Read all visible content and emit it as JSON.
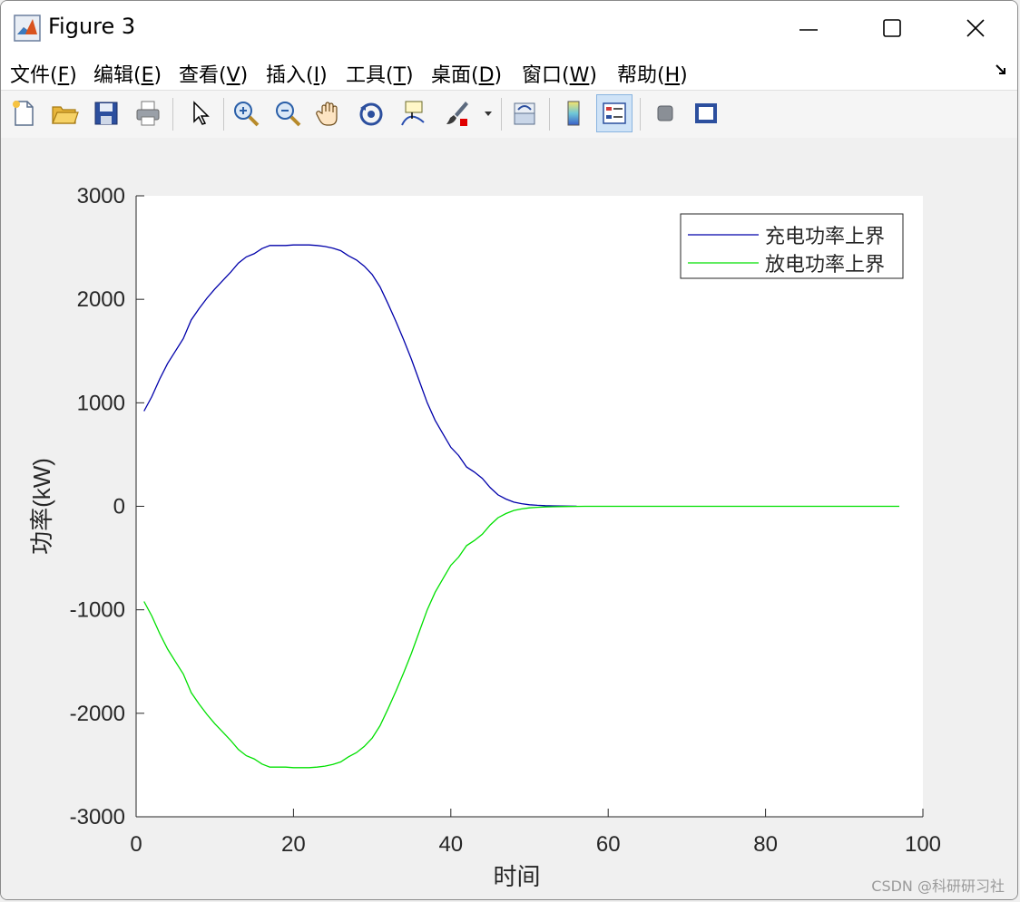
{
  "window": {
    "title": "Figure 3",
    "icons": {
      "app": "matlab-logo-icon",
      "minimize": "minimize-icon",
      "maximize": "maximize-icon",
      "close": "close-icon"
    }
  },
  "menu": {
    "items": [
      {
        "label": "文件(",
        "key": "F",
        "end": ")"
      },
      {
        "label": "编辑(",
        "key": "E",
        "end": ")"
      },
      {
        "label": "查看(",
        "key": "V",
        "end": ")"
      },
      {
        "label": "插入(",
        "key": "I",
        "end": ")"
      },
      {
        "label": "工具(",
        "key": "T",
        "end": ")"
      },
      {
        "label": "桌面(",
        "key": "D",
        "end": ")"
      },
      {
        "label": "窗口(",
        "key": "W",
        "end": ")"
      },
      {
        "label": "帮助(",
        "key": "H",
        "end": ")"
      }
    ],
    "dock_icon": "dock-arrow-icon"
  },
  "toolbar": {
    "buttons": [
      "new-figure-icon",
      "open-file-icon",
      "save-icon",
      "print-icon",
      "select-pointer-icon",
      "zoom-in-icon",
      "zoom-out-icon",
      "pan-hand-icon",
      "rotate-3d-icon",
      "data-cursor-icon",
      "brush-icon",
      "brush-dropdown-icon",
      "link-plot-icon",
      "colorbar-icon",
      "legend-icon",
      "hide-plot-tools-icon",
      "show-plot-tools-icon"
    ],
    "active": "legend-icon"
  },
  "watermark": "CSDN @科研研习社",
  "chart_data": {
    "type": "line",
    "title": "",
    "xlabel": "时间",
    "ylabel": "功率(kW)",
    "xlim": [
      0,
      100
    ],
    "ylim": [
      -3000,
      3000
    ],
    "xticks": [
      0,
      20,
      40,
      60,
      80,
      100
    ],
    "yticks": [
      3000,
      2000,
      1000,
      0,
      -1000,
      -2000,
      -3000
    ],
    "grid": false,
    "legend_position": "top-right",
    "series": [
      {
        "name": "充电功率上界",
        "color": "#0000aa",
        "x": [
          1,
          2,
          3,
          4,
          5,
          6,
          7,
          8,
          9,
          10,
          11,
          12,
          13,
          14,
          15,
          16,
          17,
          18,
          19,
          20,
          21,
          22,
          23,
          24,
          25,
          26,
          27,
          28,
          29,
          30,
          31,
          32,
          33,
          34,
          35,
          36,
          37,
          38,
          39,
          40,
          41,
          42,
          43,
          44,
          45,
          46,
          47,
          48,
          49,
          50,
          51,
          52,
          53,
          54,
          55,
          56
        ],
        "values": [
          920,
          1060,
          1230,
          1380,
          1500,
          1620,
          1800,
          1910,
          2010,
          2100,
          2180,
          2260,
          2350,
          2410,
          2440,
          2490,
          2520,
          2520,
          2520,
          2525,
          2525,
          2525,
          2520,
          2510,
          2495,
          2470,
          2420,
          2380,
          2320,
          2240,
          2120,
          1960,
          1790,
          1610,
          1420,
          1210,
          1000,
          830,
          700,
          570,
          490,
          380,
          330,
          270,
          180,
          110,
          70,
          40,
          25,
          15,
          10,
          6,
          4,
          3,
          2,
          1
        ]
      },
      {
        "name": "放电功率上界",
        "color": "#00e000",
        "x": [
          1,
          2,
          3,
          4,
          5,
          6,
          7,
          8,
          9,
          10,
          11,
          12,
          13,
          14,
          15,
          16,
          17,
          18,
          19,
          20,
          21,
          22,
          23,
          24,
          25,
          26,
          27,
          28,
          29,
          30,
          31,
          32,
          33,
          34,
          35,
          36,
          37,
          38,
          39,
          40,
          41,
          42,
          43,
          44,
          45,
          46,
          47,
          48,
          49,
          50,
          51,
          52,
          53,
          54,
          55,
          56,
          57,
          58,
          59,
          60,
          61,
          62,
          63,
          64,
          65,
          66,
          67,
          68,
          69,
          70,
          71,
          72,
          73,
          74,
          75,
          76,
          77,
          78,
          79,
          80,
          81,
          82,
          83,
          84,
          85,
          86,
          87,
          88,
          89,
          90,
          91,
          92,
          93,
          94,
          95,
          96,
          97
        ],
        "values": [
          -920,
          -1060,
          -1230,
          -1380,
          -1500,
          -1620,
          -1800,
          -1910,
          -2010,
          -2100,
          -2180,
          -2260,
          -2350,
          -2410,
          -2440,
          -2490,
          -2520,
          -2520,
          -2520,
          -2525,
          -2525,
          -2525,
          -2520,
          -2510,
          -2495,
          -2470,
          -2420,
          -2380,
          -2320,
          -2240,
          -2120,
          -1960,
          -1790,
          -1610,
          -1420,
          -1210,
          -1000,
          -830,
          -700,
          -570,
          -490,
          -380,
          -330,
          -270,
          -180,
          -110,
          -70,
          -40,
          -25,
          -15,
          -10,
          -6,
          -4,
          -3,
          -2,
          -1,
          0,
          0,
          0,
          0,
          0,
          0,
          0,
          0,
          0,
          0,
          0,
          0,
          0,
          0,
          0,
          0,
          0,
          0,
          0,
          0,
          0,
          0,
          0,
          0,
          0,
          0,
          0,
          0,
          0,
          0,
          0,
          0,
          0,
          0,
          0,
          0,
          0,
          0,
          0,
          0,
          0
        ]
      }
    ]
  }
}
